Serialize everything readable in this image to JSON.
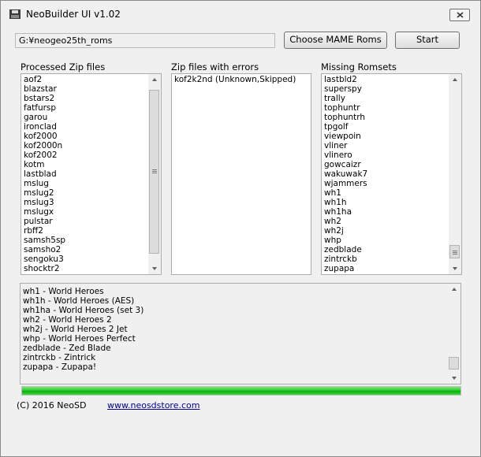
{
  "window": {
    "title": "NeoBuilder UI v1.02"
  },
  "toolbar": {
    "path_value": "G:¥neogeo25th_roms",
    "choose_label": "Choose MAME Roms",
    "start_label": "Start"
  },
  "processed": {
    "label": "Processed Zip files",
    "items": [
      "aof2",
      "blazstar",
      "bstars2",
      "fatfursp",
      "garou",
      "ironclad",
      "kof2000",
      "kof2000n",
      "kof2002",
      "kotm",
      "lastblad",
      "mslug",
      "mslug2",
      "mslug3",
      "mslugx",
      "pulstar",
      "rbff2",
      "samsh5sp",
      "samsho2",
      "sengoku3",
      "shocktr2"
    ]
  },
  "errors": {
    "label": "Zip files with errors",
    "items": [
      "kof2k2nd (Unknown,Skipped)"
    ]
  },
  "missing": {
    "label": "Missing Romsets",
    "items": [
      "lastbld2",
      "superspy",
      "trally",
      "tophuntr",
      "tophuntrh",
      "tpgolf",
      "viewpoin",
      "vliner",
      "vlinero",
      "gowcaizr",
      "wakuwak7",
      "wjammers",
      "wh1",
      "wh1h",
      "wh1ha",
      "wh2",
      "wh2j",
      "whp",
      "zedblade",
      "zintrckb",
      "zupapa"
    ]
  },
  "log": {
    "lines": [
      "wh1 - World Heroes",
      "wh1h - World Heroes (AES)",
      "wh1ha - World Heroes (set 3)",
      "wh2 - World Heroes 2",
      "wh2j - World Heroes 2 Jet",
      "whp - World Heroes Perfect",
      "zedblade - Zed Blade",
      "zintrckb - Zintrick",
      "zupapa - Zupapa!"
    ]
  },
  "progress": {
    "value": 1.0,
    "color": "#06b006"
  },
  "footer": {
    "copyright": "(C) 2016 NeoSD",
    "link": "www.neosdstore.com"
  },
  "icons": {
    "app": "floppy-disk-icon",
    "close": "close-icon",
    "scroll_up": "scroll-up-arrow-icon",
    "scroll_down": "scroll-down-arrow-icon"
  }
}
